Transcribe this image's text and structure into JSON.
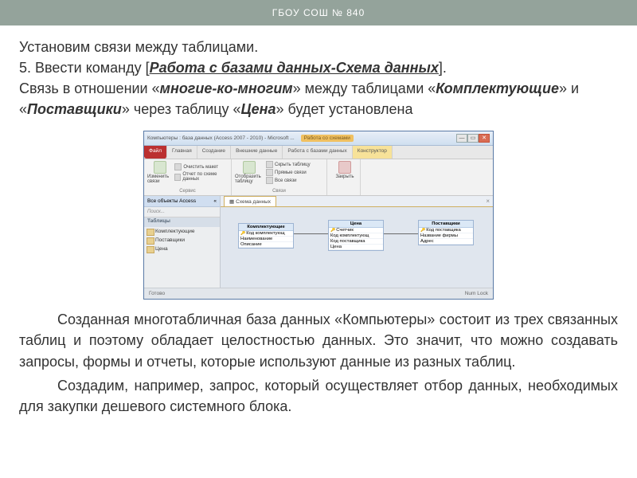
{
  "header": {
    "title": "ГБОУ СОШ № 840"
  },
  "p1": {
    "t1": "Установим связи между таблицами.",
    "t2": "5. Ввести команду [",
    "cmd": "Работа с базами данных-Схема данных",
    "t3": "].",
    "t4": "Связь в отношении «",
    "rel": "многие-ко-многим",
    "t5": "» между таблицами «",
    "tab1": "Комплектующие",
    "t6": "» и «",
    "tab2": "Поставщики",
    "t7": "» через таблицу «",
    "tab3": "Цена",
    "t8": "» будет установлена"
  },
  "p2": "Созданная многотабличная база данных «Компьютеры» состоит из трех связанных таблиц и поэтому обладает целостностью данных. Это значит, что можно создавать запросы, формы и отчеты, которые используют данные из разных таблиц.",
  "p3": "Создадим, например, запрос, который осуществляет отбор данных, необходимых для закупки дешевого системного блока.",
  "app": {
    "title": "Компьютеры : база данных (Access 2007 - 2010) - Microsoft ...",
    "ctx_tab": "Работа со схемами",
    "tabs": {
      "file": "Файл",
      "home": "Главная",
      "create": "Создание",
      "ext": "Внешние данные",
      "db": "Работа с базами данных",
      "con": "Конструктор"
    },
    "ribbon": {
      "g1": {
        "big": "Изменить связи",
        "i1": "Отчет по схеме данных",
        "i2": "Очистить макет",
        "title": "Сервис"
      },
      "g2": {
        "big": "Отобразить таблицу",
        "i1": "Скрыть таблицу",
        "i2": "Прямые связи",
        "i3": "Все связи",
        "title": "Связи"
      },
      "g3": {
        "big": "Закрыть",
        "title": ""
      }
    },
    "side": {
      "head": "Все объекты Access",
      "search": "Поиск...",
      "cat": "Таблицы",
      "items": [
        "Комплектующие",
        "Поставщики",
        "Цена"
      ]
    },
    "canvas": {
      "tab": "Схема данных",
      "t1": {
        "name": "Комплектующие",
        "rows": [
          "Код комплектующ",
          "Наименование",
          "Описание"
        ]
      },
      "t2": {
        "name": "Цена",
        "rows": [
          "Счетчик",
          "Код комплектующ",
          "Код поставщика",
          "Цена"
        ]
      },
      "t3": {
        "name": "Поставщики",
        "rows": [
          "Код поставщика",
          "Название фирмы",
          "Адрес"
        ]
      }
    },
    "status": {
      "l": "Готово",
      "r": "Num Lock"
    }
  }
}
